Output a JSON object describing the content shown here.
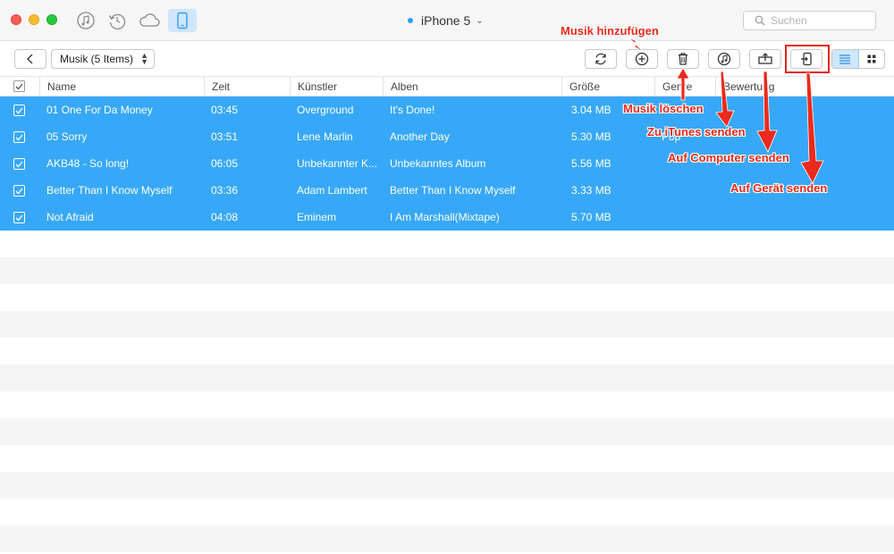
{
  "window": {
    "device_name": "iPhone 5",
    "search_placeholder": "Suchen"
  },
  "toolbar": {
    "category_select": "Musik (5 Items)"
  },
  "table": {
    "columns": [
      "Name",
      "Zeit",
      "Künstler",
      "Alben",
      "Größe",
      "Genre",
      "Bewertung"
    ],
    "rows": [
      {
        "name": "01 One For Da Money",
        "time": "03:45",
        "artist": "Overground",
        "album": "It's Done!",
        "size": "3.04 MB",
        "genre": ""
      },
      {
        "name": "05 Sorry",
        "time": "03:51",
        "artist": "Lene Marlin",
        "album": "Another Day",
        "size": "5.30 MB",
        "genre": "Pop"
      },
      {
        "name": "AKB48 - So long!",
        "time": "06:05",
        "artist": "Unbekannter K...",
        "album": "Unbekanntes Album",
        "size": "5.56 MB",
        "genre": ""
      },
      {
        "name": "Better Than I Know Myself",
        "time": "03:36",
        "artist": "Adam Lambert",
        "album": "Better Than I Know Myself",
        "size": "3.33 MB",
        "genre": ""
      },
      {
        "name": "Not Afraid",
        "time": "04:08",
        "artist": "Eminem",
        "album": "I Am Marshall(Mixtape)",
        "size": "5.70 MB",
        "genre": ""
      }
    ]
  },
  "annotations": {
    "add": "Musik hinzufügen",
    "delete": "Musik löschen",
    "to_itunes": "Zu iTunes senden",
    "to_computer": "Auf Computer senden",
    "to_device": "Auf Gerät senden"
  },
  "colors": {
    "selection": "#37a8f7",
    "annotation": "#e8281c",
    "accent": "#2e9cf3"
  }
}
